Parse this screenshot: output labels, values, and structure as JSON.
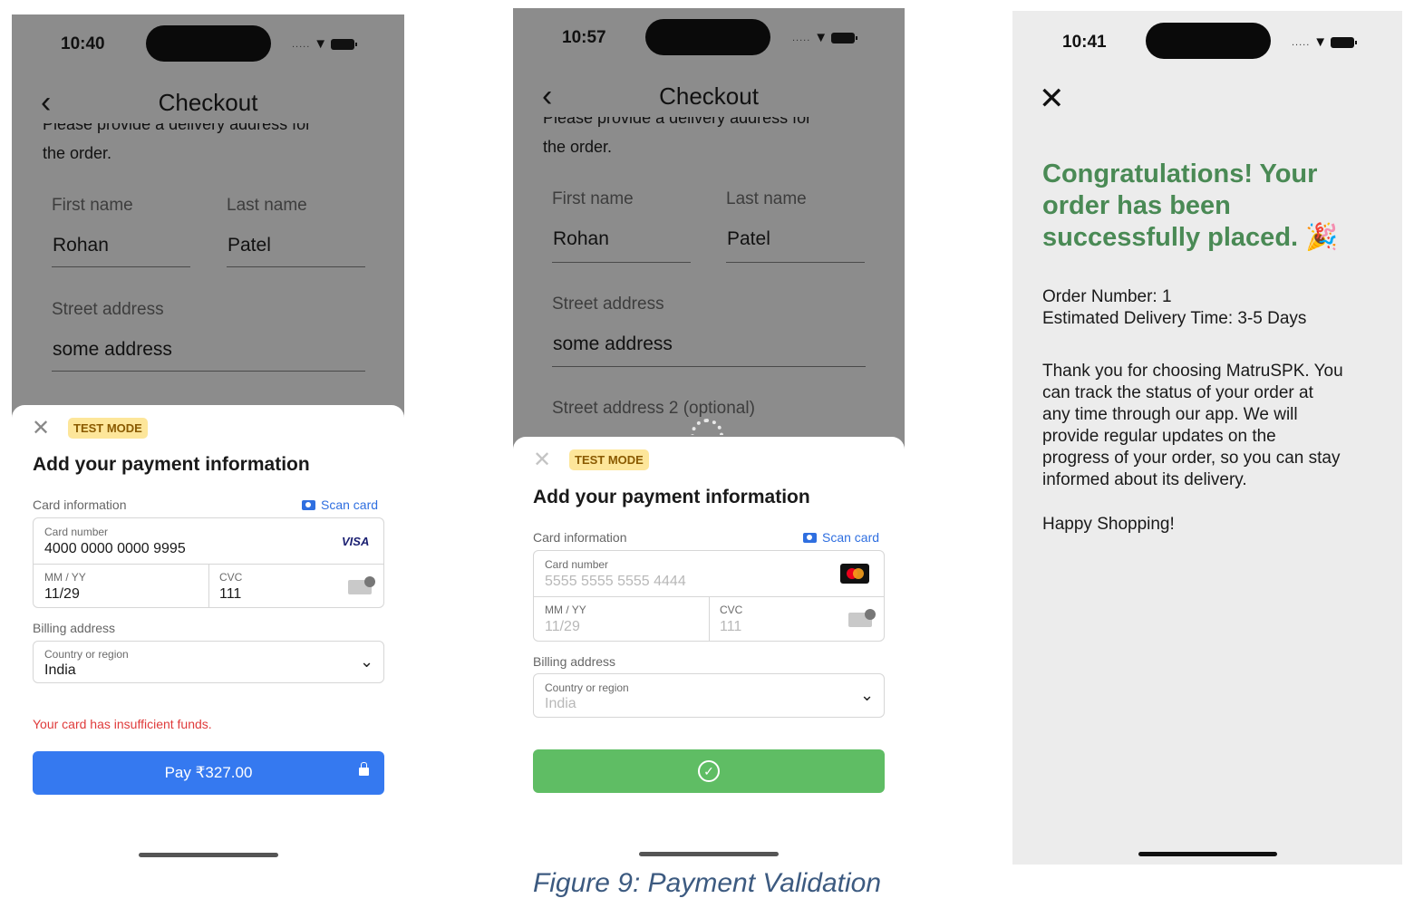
{
  "phone1": {
    "time": "10:40",
    "status_dots": ".....",
    "title": "Checkout",
    "clipped_line": "Please provide a delivery address for",
    "clipped_line2": "the order.",
    "first_name_label": "First name",
    "first_name_value": "Rohan",
    "last_name_label": "Last name",
    "last_name_value": "Patel",
    "street_label": "Street address",
    "street_value": "some address",
    "sheet": {
      "badge": "TEST MODE",
      "title": "Add your payment information",
      "card_info_label": "Card information",
      "scan_card": "Scan card",
      "card_number_label": "Card number",
      "card_number": "4000 0000 0000 9995",
      "card_brand": "VISA",
      "expiry_label": "MM / YY",
      "expiry": "11/29",
      "cvc_label": "CVC",
      "cvc": "111",
      "billing_label": "Billing address",
      "country_label": "Country or region",
      "country": "India",
      "error": "Your card has insufficient funds.",
      "pay_button": "Pay ₹327.00"
    }
  },
  "phone2": {
    "time": "10:57",
    "status_dots": ".....",
    "title": "Checkout",
    "clipped_line": "Please provide a delivery address for",
    "clipped_line2": "the order.",
    "first_name_label": "First name",
    "first_name_value": "Rohan",
    "last_name_label": "Last name",
    "last_name_value": "Patel",
    "street_label": "Street address",
    "street_value": "some address",
    "street2_label": "Street address 2 (optional)",
    "sheet": {
      "badge": "TEST MODE",
      "title": "Add your payment information",
      "card_info_label": "Card information",
      "scan_card": "Scan card",
      "card_number_label": "Card number",
      "card_number": "5555 5555 5555 4444",
      "expiry_label": "MM / YY",
      "expiry": "11/29",
      "cvc_label": "CVC",
      "cvc": "111",
      "billing_label": "Billing address",
      "country_label": "Country or region",
      "country": "India"
    }
  },
  "phone3": {
    "time": "10:41",
    "status_dots": ".....",
    "headline_line1": "Congratulations! Your",
    "headline_line2": "order has been",
    "headline_line3": "successfully placed. 🎉",
    "order_number": "Order Number: 1",
    "delivery_time": "Estimated Delivery Time: 3-5 Days",
    "thanks_l1": "Thank you for choosing MatruSPK. You",
    "thanks_l2": "can track the status of your order at",
    "thanks_l3": "any time through our app. We will",
    "thanks_l4": "provide regular updates on the",
    "thanks_l5": "progress of your order, so you can stay",
    "thanks_l6": "informed about its delivery.",
    "closing": "Happy Shopping!"
  },
  "caption": "Figure 9: Payment Validation",
  "colors": {
    "overlay_gray": "#8c8c8c",
    "pay_blue": "#3579f0",
    "success_green": "#5fbd64",
    "congrats_green": "#4a8a55",
    "error_red": "#df3b3b",
    "badge_yellow": "#fde69a"
  }
}
